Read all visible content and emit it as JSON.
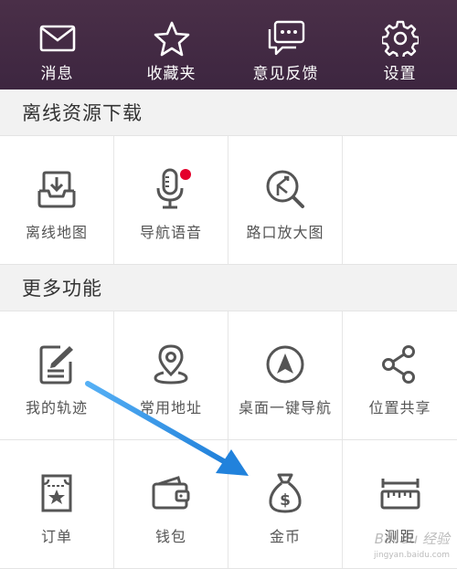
{
  "topbar": {
    "items": [
      {
        "label": "消息",
        "icon": "envelope-icon"
      },
      {
        "label": "收藏夹",
        "icon": "star-icon"
      },
      {
        "label": "意见反馈",
        "icon": "chat-bubble-icon"
      },
      {
        "label": "设置",
        "icon": "gear-icon"
      }
    ],
    "background": "#42293f"
  },
  "offline": {
    "title": "离线资源下载",
    "items": [
      {
        "label": "离线地图",
        "icon": "download-tray-icon"
      },
      {
        "label": "导航语音",
        "icon": "microphone-icon",
        "badge": true
      },
      {
        "label": "路口放大图",
        "icon": "junction-zoom-icon"
      }
    ]
  },
  "more": {
    "title": "更多功能",
    "row1": [
      {
        "label": "我的轨迹",
        "icon": "track-edit-icon"
      },
      {
        "label": "常用地址",
        "icon": "location-pin-icon"
      },
      {
        "label": "桌面一键导航",
        "icon": "navigation-arrow-icon"
      },
      {
        "label": "位置共享",
        "icon": "share-icon"
      }
    ],
    "row2": [
      {
        "label": "订单",
        "icon": "ticket-icon"
      },
      {
        "label": "钱包",
        "icon": "wallet-icon"
      },
      {
        "label": "金币",
        "icon": "money-bag-icon"
      },
      {
        "label": "测距",
        "icon": "ruler-icon"
      }
    ]
  },
  "colors": {
    "accent_arrow": "#2f8fe6",
    "badge": "#e4002b",
    "icon_gray": "#555555"
  }
}
